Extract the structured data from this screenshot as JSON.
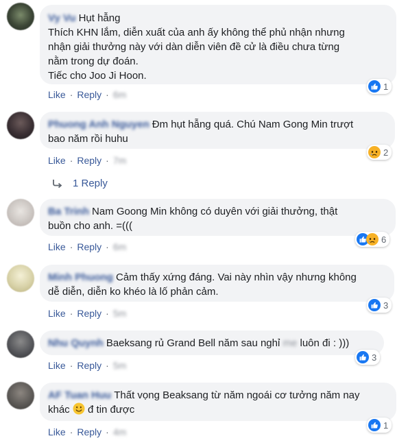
{
  "comments": [
    {
      "name": "Vy Vu",
      "lines": [
        "Hụt hẫng",
        "Thích KHN lắm, diễn xuất của anh ấy không thể phủ nhận nhưng",
        "nhận giải thưởng này với dàn diễn viên đề cử là điều chưa từng",
        "nằm trong dự đoán.",
        "Tiếc cho Joo Ji Hoon."
      ],
      "like": "Like",
      "reply": "Reply",
      "time": "6m",
      "reaction_count": "1",
      "reactions": [
        "like-icon"
      ]
    },
    {
      "name": "Phuong Anh Nguyen",
      "lines": [
        "Đm hụt hẫng quá. Chú Nam Gong Min trượt",
        "bao năm rồi huhu"
      ],
      "like": "Like",
      "reply": "Reply",
      "time": "7m",
      "reaction_count": "2",
      "reactions": [
        "sad-icon"
      ],
      "replies_label": "1 Reply"
    },
    {
      "name": "Ba Trinh",
      "lines": [
        "Nam Goong Min không có duyên với giải thưởng, thật",
        "buồn cho anh. =((("
      ],
      "like": "Like",
      "reply": "Reply",
      "time": "6m",
      "reaction_count": "6",
      "reactions": [
        "like-icon",
        "sad-icon"
      ]
    },
    {
      "name": "Minh Phuong",
      "lines": [
        "Cảm thấy xứng đáng. Vai này nhìn vậy nhưng không",
        "dễ diễn, diễn ko khéo là lố phản cảm."
      ],
      "like": "Like",
      "reply": "Reply",
      "time": "5m",
      "reaction_count": "3",
      "reactions": [
        "like-icon"
      ]
    },
    {
      "name": "Nhu Quynh",
      "line_before": "Baeksang rủ Grand Bell năm sau nghỉ",
      "line_hidden": "me",
      "line_after": "luôn đi : )))",
      "like": "Like",
      "reply": "Reply",
      "time": "5m",
      "reaction_count": "3",
      "reactions": [
        "like-icon"
      ]
    },
    {
      "name": "AF Tuan Huu",
      "lines": [
        "Thất vọng Beaksang từ năm ngoái cơ tưởng năm nay"
      ],
      "line2_before": "khác",
      "line2_after": "đ tin được",
      "like": "Like",
      "reply": "Reply",
      "time": "4m",
      "reaction_count": "1",
      "reactions": [
        "like-icon"
      ]
    }
  ]
}
